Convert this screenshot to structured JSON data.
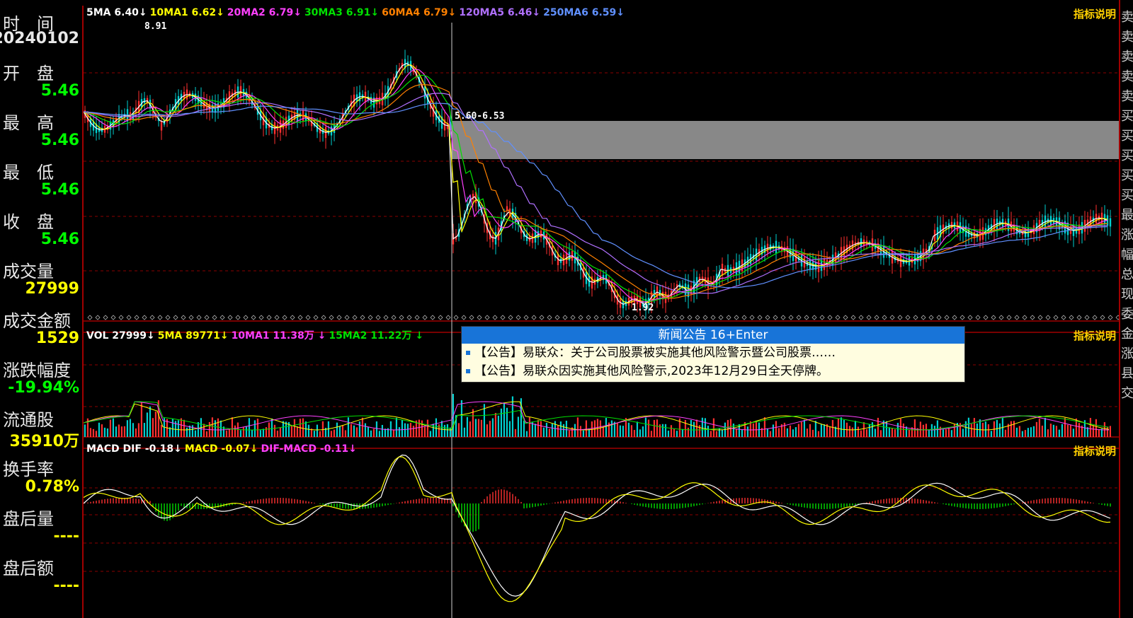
{
  "info_panel": {
    "rows": [
      {
        "label": "时　间",
        "value": "20240102",
        "color": "#e8e8e8"
      },
      {
        "label": "开　盘",
        "value": "5.46",
        "color": "#00ff00"
      },
      {
        "label": "最　高",
        "value": "5.46",
        "color": "#00ff00"
      },
      {
        "label": "最　低",
        "value": "5.46",
        "color": "#00ff00"
      },
      {
        "label": "收　盘",
        "value": "5.46",
        "color": "#00ff00"
      },
      {
        "label": "成交量",
        "value": "27999",
        "color": "#ffff00"
      },
      {
        "label": "成交金额",
        "value": "1529",
        "color": "#ffff00"
      },
      {
        "label": "涨跌幅度",
        "value": "-19.94%",
        "color": "#00ff00"
      },
      {
        "label": "流通股",
        "value": "35910万",
        "color": "#ffff00"
      },
      {
        "label": "换手率",
        "value": "0.78%",
        "color": "#ffff00"
      },
      {
        "label": "盘后量",
        "value": "----",
        "color": "#ffff00"
      },
      {
        "label": "盘后额",
        "value": "----",
        "color": "#ffff00"
      }
    ]
  },
  "main_panel": {
    "ma_legend": [
      {
        "text": "5MA 6.40↓",
        "color": "#ffffff"
      },
      {
        "text": "10MA1 6.62↓",
        "color": "#ffff00"
      },
      {
        "text": "20MA2 6.79↓",
        "color": "#ff40ff"
      },
      {
        "text": "30MA3 6.91↓",
        "color": "#00e000"
      },
      {
        "text": "60MA4 6.79↓",
        "color": "#ff8000"
      },
      {
        "text": "120MA5 6.46↓",
        "color": "#b070ff"
      },
      {
        "text": "250MA6 6.59↓",
        "color": "#6090ff"
      }
    ],
    "index_link": "指标说明",
    "annotations": {
      "high": "8.91",
      "low": "1.92",
      "gap": "5.60-6.53"
    }
  },
  "volume_panel": {
    "legend": [
      {
        "text": "VOL 27999↓",
        "color": "#ffffff"
      },
      {
        "text": "5MA 89771↓",
        "color": "#ffff00"
      },
      {
        "text": "10MA1 11.38万 ↓",
        "color": "#ff40ff"
      },
      {
        "text": "15MA2 11.22万 ↓",
        "color": "#00e000"
      }
    ],
    "index_link": "指标说明"
  },
  "macd_panel": {
    "legend": [
      {
        "text": "MACD DIF -0.18↓",
        "color": "#ffffff"
      },
      {
        "text": "MACD -0.07↓",
        "color": "#ffff00"
      },
      {
        "text": "DIF-MACD -0.11↓",
        "color": "#ff40ff"
      }
    ],
    "index_link": "指标说明"
  },
  "news_popup": {
    "title": "新闻公告  16+Enter",
    "items": [
      "【公告】易联众：关于公司股票被实施其他风险警示暨公司股票……",
      "【公告】易联众因实施其他风险警示,2023年12月29日全天停牌。"
    ]
  },
  "right_strip": {
    "chars": [
      "卖",
      "卖",
      "卖",
      "卖",
      "卖",
      "买",
      "买",
      "买",
      "买",
      "买",
      "最",
      "涨",
      "幅",
      "总",
      "现",
      "委",
      "金",
      "涨",
      "县",
      "交"
    ]
  },
  "colors": {
    "grid": "#8b0000",
    "up": "#ff3030",
    "down": "#00d0d0",
    "gap_band": "#888888"
  }
}
